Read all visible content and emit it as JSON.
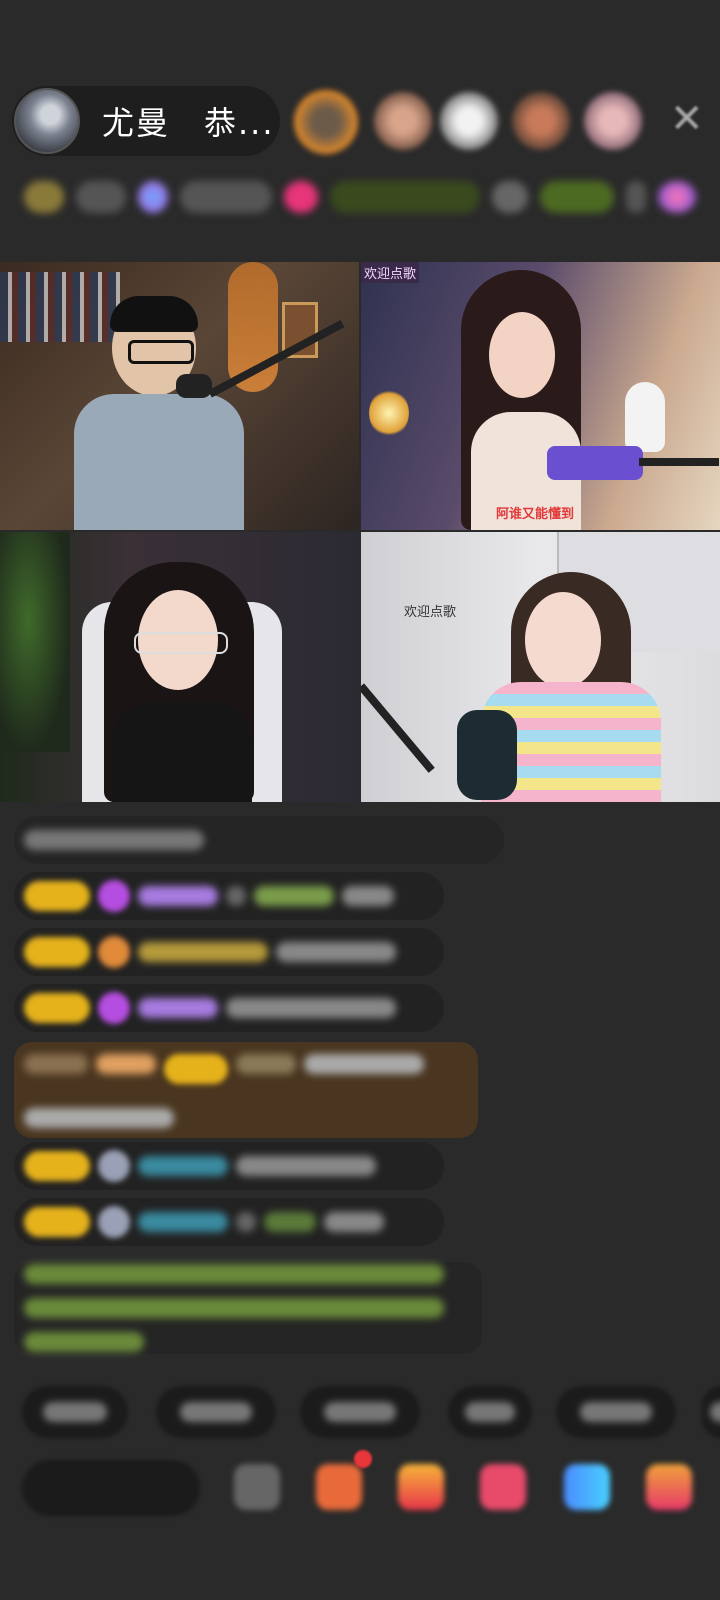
{
  "host": {
    "name": "尤曼　恭..."
  },
  "close_icon": "close-icon",
  "video_labels": {
    "tile2_top": "欢迎点歌",
    "tile2_bottom": "阿谁又能懂到",
    "tile4_top": "欢迎点歌"
  },
  "colors": {
    "background": "#2a2a2a",
    "badge_gold": "#e5b21c",
    "highlight_brown": "#5a3c1e",
    "system_green": "#8fc15a"
  }
}
